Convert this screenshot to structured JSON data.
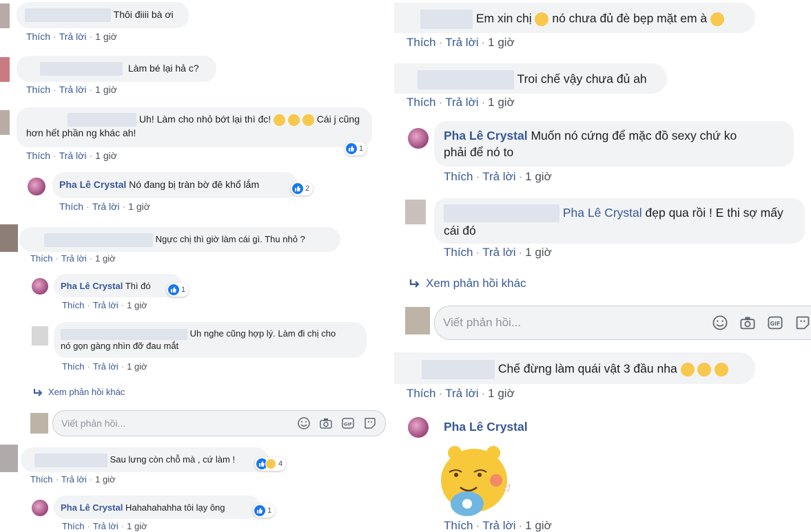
{
  "actions": {
    "like": "Thích",
    "reply": "Trả lời",
    "time": "1 giờ",
    "sep": "·"
  },
  "page_name": "Pha Lê Crystal",
  "left": {
    "c1": {
      "text": "Thôi điiii bà ơi"
    },
    "c2": {
      "text": "Làm bé lại hả c?"
    },
    "c3": {
      "text_a": "Uh! Làm cho nhỏ bớt lại thì đc!",
      "text_b": "Cái j cũng",
      "text_c": "hơn hết phần ng khác ah!",
      "reactions": "1"
    },
    "r1": {
      "text": "Nó đang bị tràn bờ đê khổ lắm",
      "reactions": "2"
    },
    "c4": {
      "text": "Ngực chị thì giờ làm cái gì. Thu nhỏ ?"
    },
    "r2": {
      "text": "Thì đó",
      "reactions": "1"
    },
    "r3": {
      "text_a": "Uh nghe cũng hợp lý. Làm đi chị cho",
      "text_b": "nó gọn gàng nhìn đỡ đau mắt"
    },
    "more": "Xem phản hồi khác",
    "reply_placeholder": "Viết phản hồi...",
    "c5": {
      "text": "Sau lưng còn chỗ mà , cứ làm !",
      "reactions": "4"
    },
    "r4": {
      "text": "Hahahahahha tôi lạy ông",
      "reactions": "1"
    }
  },
  "right": {
    "c1": {
      "text_a": "Em xin chị",
      "text_b": "nó chưa đủ đè bẹp mặt em à"
    },
    "c2": {
      "text": "Troi chế vậy chưa đủ ah"
    },
    "r1": {
      "text_a": "Muốn nó cứng để mặc đồ sexy chứ ko",
      "text_b": "phải để nó to"
    },
    "r2": {
      "tag": "Pha Lê Crystal",
      "text_a": "đẹp qua rồi ! E thi sợ mấy",
      "text_b": "cái đó"
    },
    "more": "Xem phản hồi khác",
    "reply_placeholder": "Viết phản hồi...",
    "c3": {
      "text": "Chế đừng làm quái vật 3 đầu nha"
    }
  },
  "colors": {
    "link": "#385898",
    "bubble": "#f2f3f5",
    "like_blue": "#1877f2",
    "meta": "#4b4f56"
  }
}
